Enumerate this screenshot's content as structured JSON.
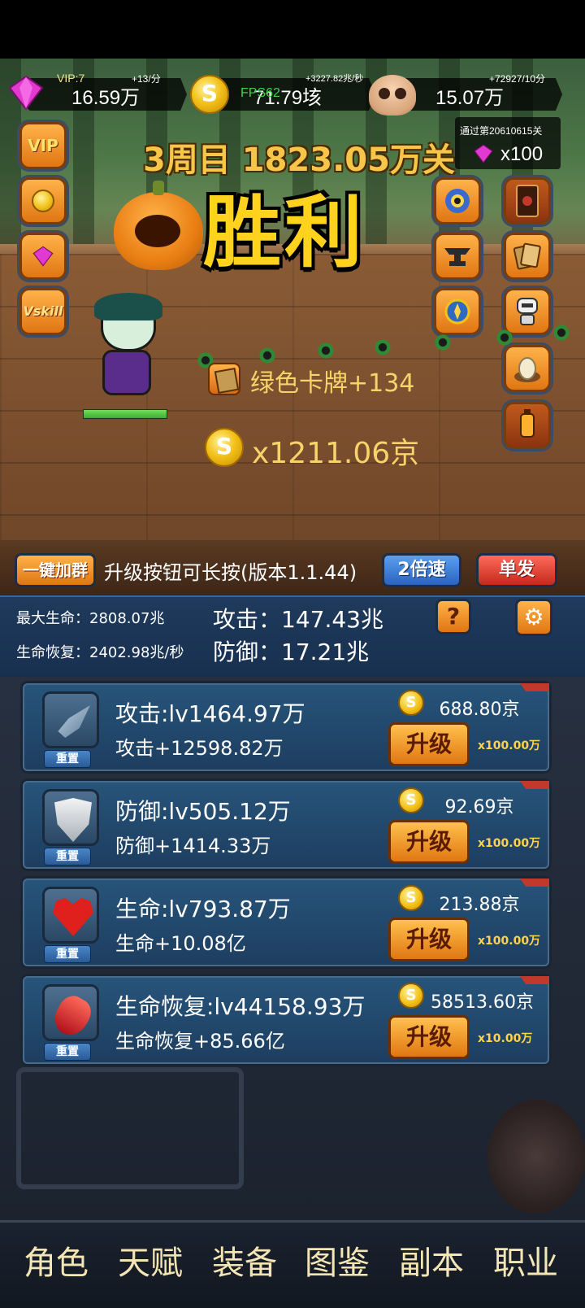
{
  "resources": {
    "vip_level": "VIP:7",
    "gems": {
      "value": "16.59万",
      "rate": "+13/分"
    },
    "gold": {
      "value": "71.79垓",
      "rate": "+3227.82兆/秒",
      "fps_label": "FPS62"
    },
    "skull": {
      "value": "15.07万",
      "rate": "+72927/10分"
    }
  },
  "stage": {
    "passed_text": "通过第20610615关",
    "passed_reward_qty": "x100",
    "title": "3周目 1823.05万关",
    "result": "胜利"
  },
  "rewards": {
    "card": "绿色卡牌+134",
    "gold": "x1211.06京"
  },
  "player_hp": 1.0,
  "side_buttons": {
    "left": [
      {
        "name": "vip-button",
        "label": "VIP"
      },
      {
        "name": "gold-shop-button",
        "label": ""
      },
      {
        "name": "gem-shop-button",
        "label": ""
      },
      {
        "name": "vskill-button",
        "label": "Vskill"
      }
    ],
    "right_icons": [
      "eye-monster-icon",
      "card-back-icon",
      "anvil-icon",
      "cards-icon",
      "compass-icon",
      "robot-icon",
      "egg-icon",
      "lantern-icon"
    ]
  },
  "controls": {
    "join_group": "一键加群",
    "tip": "升级按钮可长按(版本1.1.44)",
    "speed": "2倍速",
    "single": "单发"
  },
  "stats": {
    "max_hp_label": "最大生命：2808.07兆",
    "regen_label": "生命恢复：2402.98兆/秒",
    "attack_label": "攻击：147.43兆",
    "defense_label": "防御：17.21兆",
    "help": "?"
  },
  "upgrades": [
    {
      "icon": "dagger-icon",
      "reset": "重置",
      "level": "攻击:lv1464.97万",
      "bonus": "攻击+12598.82万",
      "cost": "688.80京",
      "button": "升级",
      "multiplier": "x100.00万"
    },
    {
      "icon": "shield-icon",
      "reset": "重置",
      "level": "防御:lv505.12万",
      "bonus": "防御+1414.33万",
      "cost": "92.69京",
      "button": "升级",
      "multiplier": "x100.00万"
    },
    {
      "icon": "heart-icon",
      "reset": "重置",
      "level": "生命:lv793.87万",
      "bonus": "生命+10.08亿",
      "cost": "213.88京",
      "button": "升级",
      "multiplier": "x100.00万"
    },
    {
      "icon": "potion-icon",
      "reset": "重置",
      "level": "生命恢复:lv44158.93万",
      "bonus": "生命恢复+85.66亿",
      "cost": "58513.60京",
      "button": "升级",
      "multiplier": "x10.00万"
    }
  ],
  "nav": [
    "角色",
    "天赋",
    "装备",
    "图鉴",
    "副本",
    "职业"
  ],
  "colors": {
    "gold_text": "#f7d36a",
    "victory": "#ffd21e",
    "panel": "#1d3e60",
    "button_orange": "#e07612"
  }
}
